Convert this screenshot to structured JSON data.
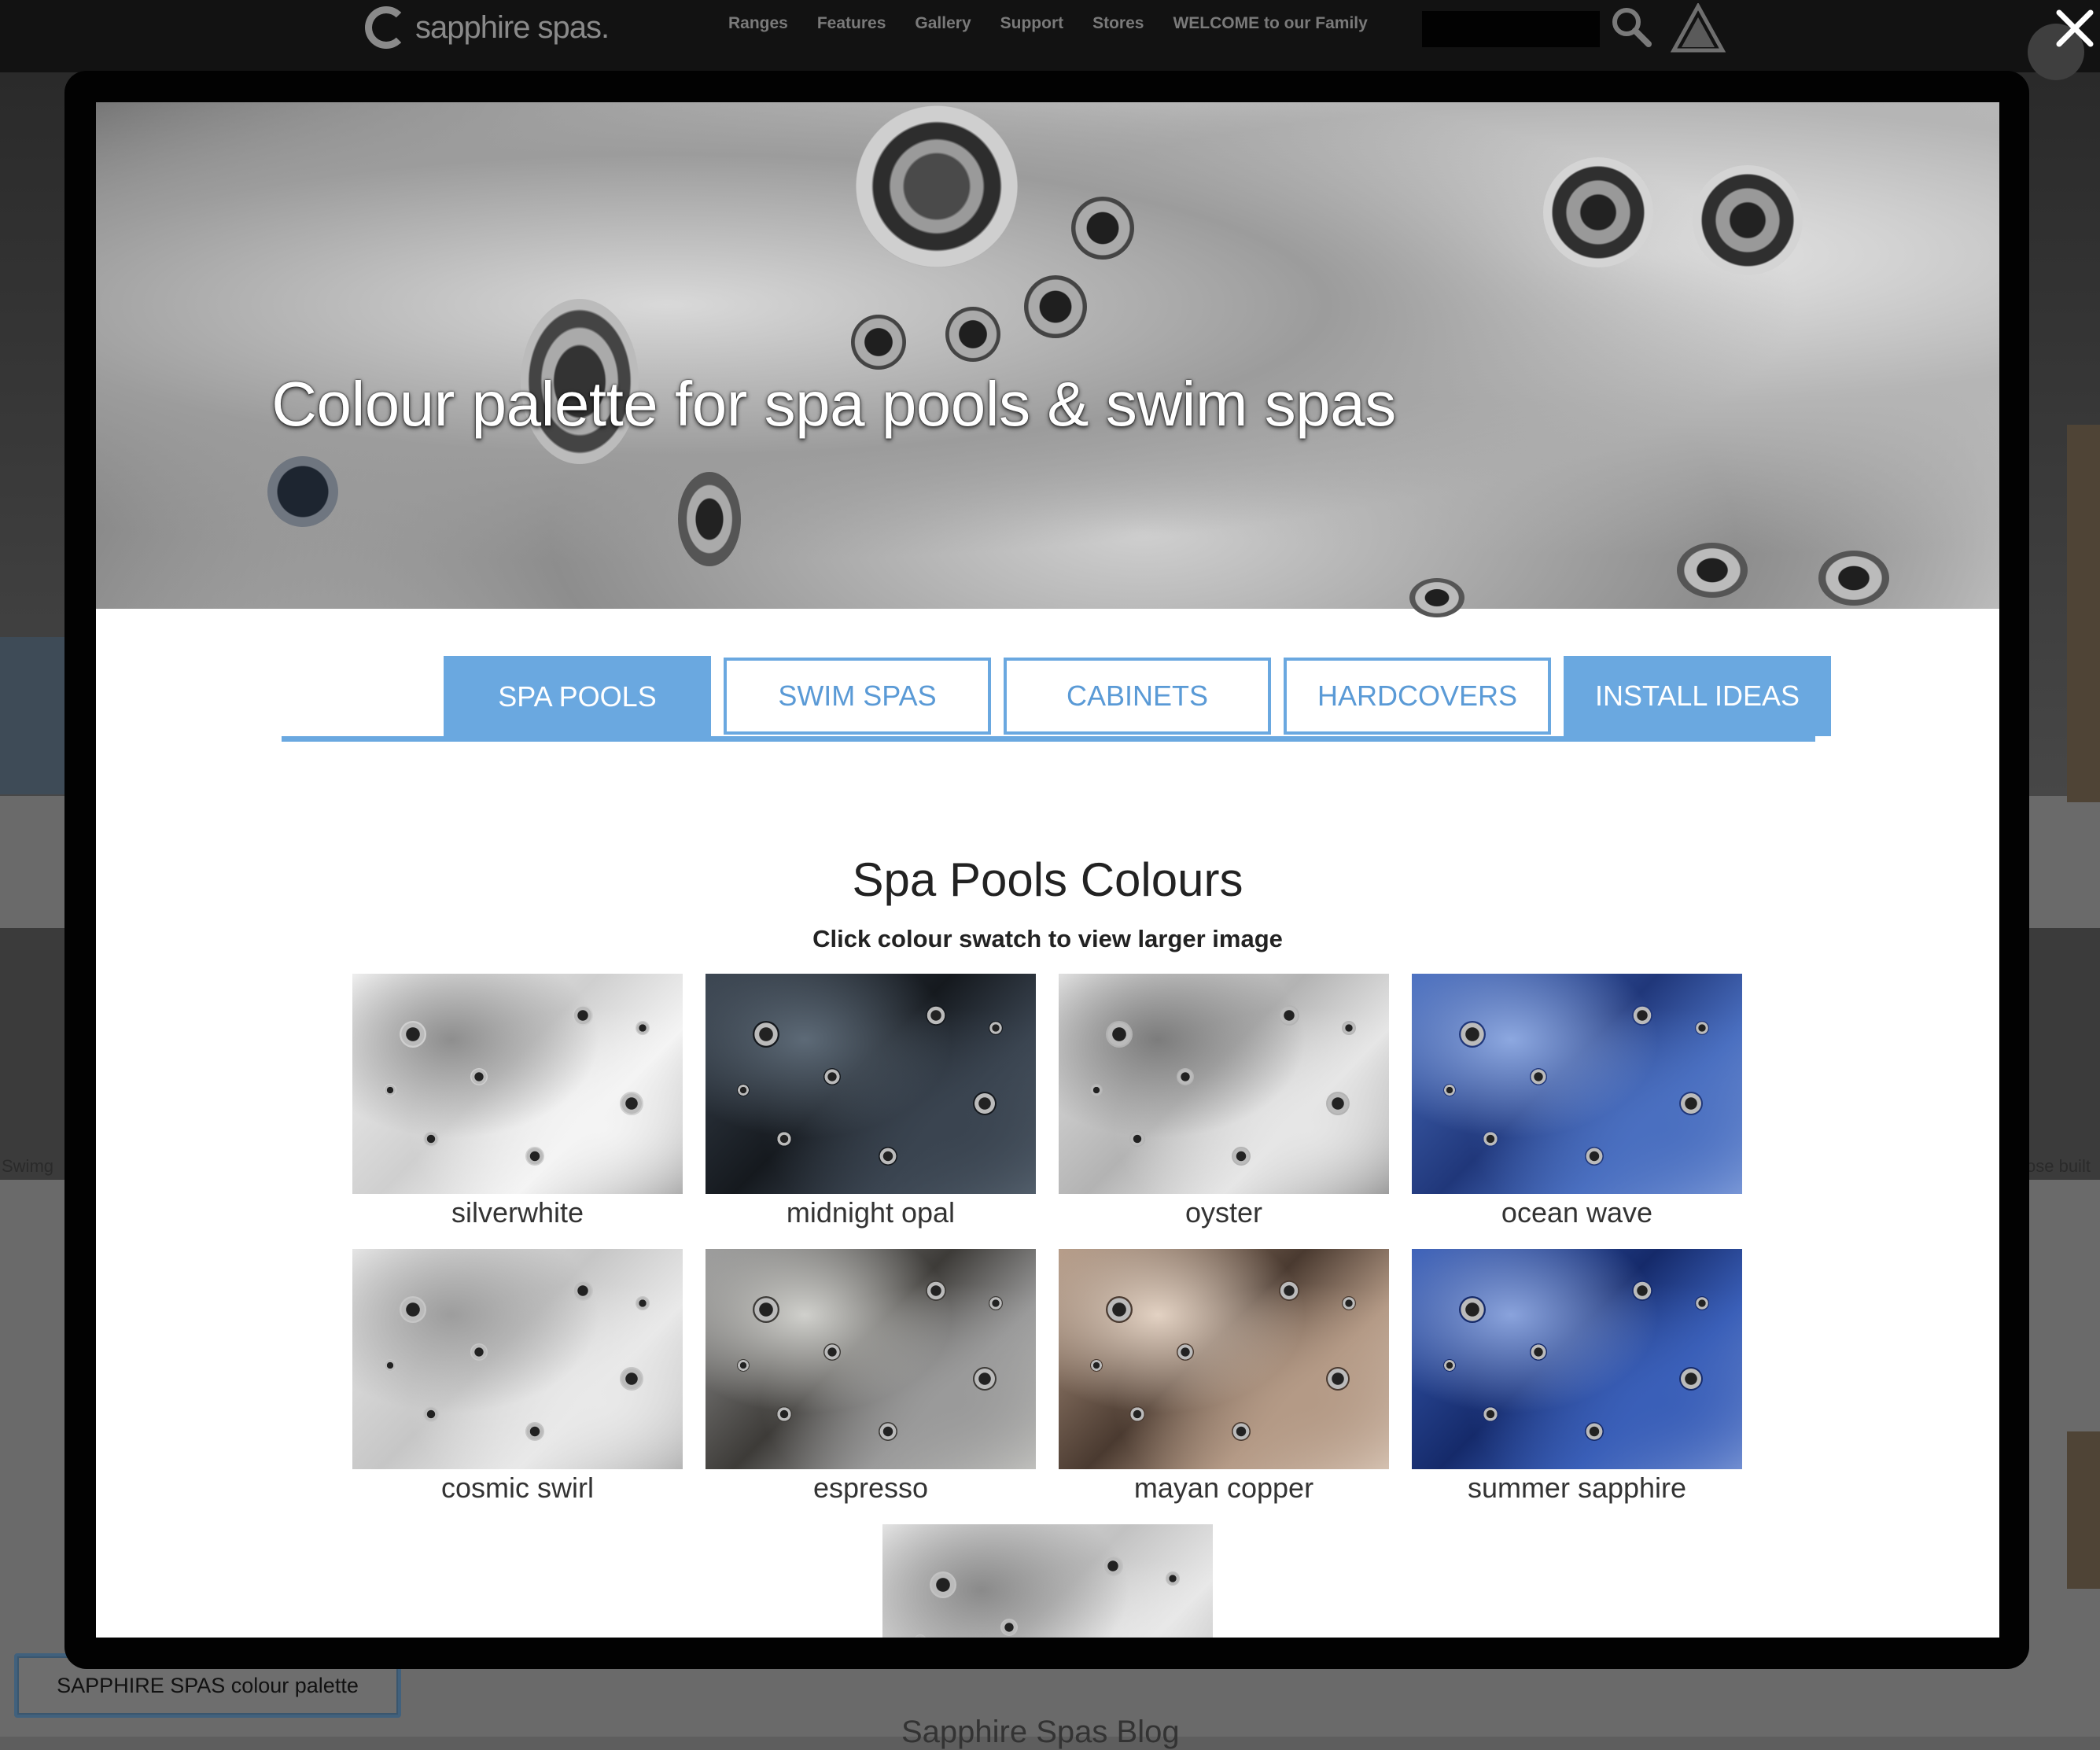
{
  "site": {
    "brand": "sapphire spas.",
    "nav": [
      "Ranges",
      "Features",
      "Gallery",
      "Support",
      "Stores",
      "WELCOME to our Family"
    ],
    "palette_button": "SAPPHIRE SPAS colour palette",
    "blog_title": "Sapphire Spas Blog",
    "left_caption": "Swimg",
    "right_caption": "ose built"
  },
  "lightbox": {
    "hero_title": "Colour palette for spa pools & swim spas",
    "tabs": [
      {
        "label": "SPA POOLS",
        "style": "filled",
        "active": true
      },
      {
        "label": "SWIM SPAS",
        "style": "outline",
        "active": false
      },
      {
        "label": "CABINETS",
        "style": "outline",
        "active": false
      },
      {
        "label": "HARDCOVERS",
        "style": "outline",
        "active": false
      },
      {
        "label": "INSTALL IDEAS",
        "style": "filled",
        "active": false
      }
    ],
    "section_title": "Spa Pools Colours",
    "section_subtitle": "Click colour swatch to view larger image",
    "swatches": [
      {
        "name": "silverwhite",
        "c1": "#f4f4f4",
        "c2": "#cfcfcf",
        "c3": "#8e8e8e"
      },
      {
        "name": "midnight opal",
        "c1": "#3a4450",
        "c2": "#15191e",
        "c3": "#5d6a77"
      },
      {
        "name": "oyster",
        "c1": "#e6e6e6",
        "c2": "#b3b3b3",
        "c3": "#7c7c7c"
      },
      {
        "name": "ocean wave",
        "c1": "#4a6fc0",
        "c2": "#20377a",
        "c3": "#8da8e0"
      },
      {
        "name": "cosmic swirl",
        "c1": "#e9e9e9",
        "c2": "#c6c6c6",
        "c3": "#9d9d9d"
      },
      {
        "name": "espresso",
        "c1": "#9a9a9a",
        "c2": "#3d3b38",
        "c3": "#d0d0cc"
      },
      {
        "name": "mayan copper",
        "c1": "#b49a86",
        "c2": "#4a3a30",
        "c3": "#e3d2c3"
      },
      {
        "name": "summer sapphire",
        "c1": "#3a5fb8",
        "c2": "#152a6a",
        "c3": "#8aa3dc"
      },
      {
        "name": "",
        "c1": "#e8e8e8",
        "c2": "#c2c2c2",
        "c3": "#8a8a8a"
      }
    ],
    "accent_color": "#6aa8e0"
  }
}
